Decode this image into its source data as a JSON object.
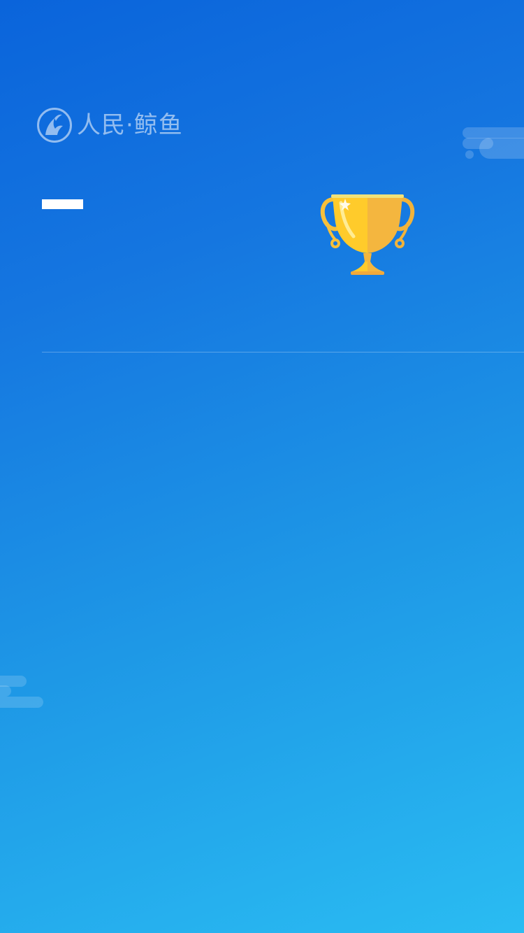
{
  "brand": {
    "name": "人民·鲸鱼",
    "logo_icon": "whale-logo-icon"
  },
  "decorations": {
    "trophy_icon": "trophy-icon",
    "cloud_icon": "cloud-icon"
  },
  "colors": {
    "gradient_start": "#0a64db",
    "gradient_end": "#2abcf2",
    "trophy_gold": "#f4b63f",
    "trophy_yellow": "#ffcb2b",
    "accent_bar": "#ffffff"
  }
}
